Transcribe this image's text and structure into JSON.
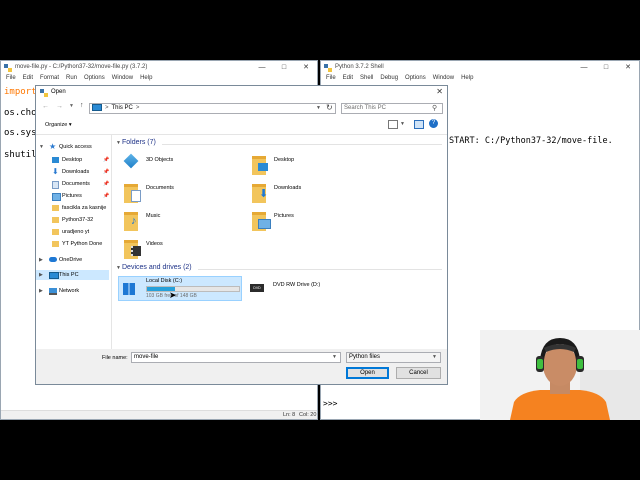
{
  "editor": {
    "title": "move-file.py - C:/Python37-32/move-file.py (3.7.2)",
    "menu": [
      "File",
      "Edit",
      "Format",
      "Run",
      "Options",
      "Window",
      "Help"
    ],
    "code_lines": [
      "import",
      "os.cho",
      "os.sys",
      "shutil"
    ],
    "status_line": "Ln: 8",
    "status_col": "Col: 20"
  },
  "shell": {
    "title": "Python 3.7.2 Shell",
    "menu": [
      "File",
      "Edit",
      "Shell",
      "Debug",
      "Options",
      "Window",
      "Help"
    ],
    "restart_text": "START: C:/Python37-32/move-file.",
    "prompt": ">>>"
  },
  "dialog": {
    "title": "Open",
    "address": [
      "This PC",
      ">"
    ],
    "search_placeholder": "Search This PC",
    "organize_label": "Organize ▾",
    "nav": [
      {
        "label": "Quick access",
        "icon": "star-icon"
      },
      {
        "label": "Desktop",
        "icon": "desktop-icon",
        "pinned": true
      },
      {
        "label": "Downloads",
        "icon": "download-icon",
        "pinned": true
      },
      {
        "label": "Documents",
        "icon": "documents-icon",
        "pinned": true
      },
      {
        "label": "Pictures",
        "icon": "pictures-icon",
        "pinned": true
      },
      {
        "label": "fascikla za kasnije",
        "icon": "folder-icon"
      },
      {
        "label": "Python37-32",
        "icon": "folder-icon"
      },
      {
        "label": "uradjeno yt",
        "icon": "folder-icon"
      },
      {
        "label": "YT Python Done",
        "icon": "folder-icon"
      },
      {
        "label": "OneDrive",
        "icon": "cloud-icon"
      },
      {
        "label": "This PC",
        "icon": "computer-icon",
        "selected": true
      },
      {
        "label": "Network",
        "icon": "network-icon"
      }
    ],
    "folders_header": "Folders (7)",
    "folders": [
      "3D Objects",
      "Desktop",
      "Documents",
      "Downloads",
      "Music",
      "Pictures",
      "Videos"
    ],
    "drives_header": "Devices and drives (2)",
    "drives": [
      {
        "name": "Local Disk (C:)",
        "free": "103 GB free of 148 GB",
        "used_fraction": 0.3
      },
      {
        "name": "DVD RW Drive (D:)"
      }
    ],
    "filename_label": "File name:",
    "filename_value": "move-file",
    "filetype_value": "Python files",
    "open_label": "Open",
    "cancel_label": "Cancel"
  }
}
